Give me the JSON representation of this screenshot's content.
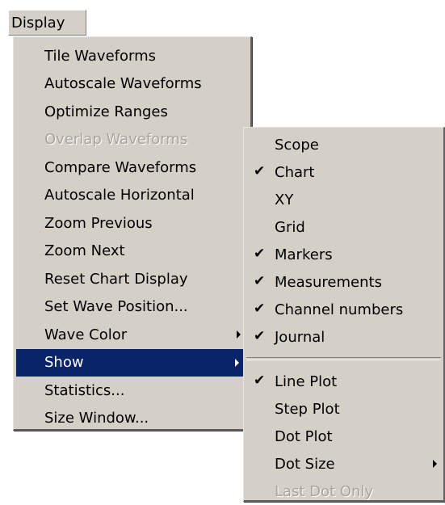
{
  "menubar": {
    "display_label": "Display"
  },
  "main_menu": {
    "items": [
      {
        "label": "Tile Waveforms",
        "enabled": true
      },
      {
        "label": "Autoscale Waveforms",
        "enabled": true
      },
      {
        "label": "Optimize Ranges",
        "enabled": true
      },
      {
        "label": "Overlap Waveforms",
        "enabled": false
      },
      {
        "label": "Compare Waveforms",
        "enabled": true
      },
      {
        "label": "Autoscale Horizontal",
        "enabled": true
      },
      {
        "label": "Zoom Previous",
        "enabled": true
      },
      {
        "label": "Zoom Next",
        "enabled": true
      },
      {
        "label": "Reset Chart Display",
        "enabled": true
      },
      {
        "label": "Set Wave Position...",
        "enabled": true
      },
      {
        "label": "Wave Color",
        "enabled": true,
        "submenu": true
      },
      {
        "label": "Show",
        "enabled": true,
        "submenu": true,
        "highlighted": true
      },
      {
        "label": "Statistics...",
        "enabled": true
      },
      {
        "label": "Size Window...",
        "enabled": true
      }
    ]
  },
  "show_submenu": {
    "items": [
      {
        "label": "Scope",
        "checked": false
      },
      {
        "label": "Chart",
        "checked": true
      },
      {
        "label": "XY",
        "checked": false
      },
      {
        "label": "Grid",
        "checked": false
      },
      {
        "label": "Markers",
        "checked": true
      },
      {
        "label": "Measurements",
        "checked": true
      },
      {
        "label": "Channel numbers",
        "checked": true
      },
      {
        "label": "Journal",
        "checked": true
      },
      {
        "label": "Line Plot",
        "checked": true
      },
      {
        "label": "Step Plot",
        "checked": false
      },
      {
        "label": "Dot Plot",
        "checked": false
      },
      {
        "label": "Dot Size",
        "checked": false,
        "submenu": true
      },
      {
        "label": "Last Dot Only",
        "checked": false,
        "enabled": false
      }
    ],
    "check_glyph": "✔"
  },
  "colors": {
    "menu_bg": "#d4d0c8",
    "highlight_bg": "#0a246a",
    "highlight_text": "#ffffff",
    "disabled_text": "#a8a59e"
  },
  "icons": {
    "submenu_arrow": "triangle-right",
    "check": "check-mark"
  }
}
